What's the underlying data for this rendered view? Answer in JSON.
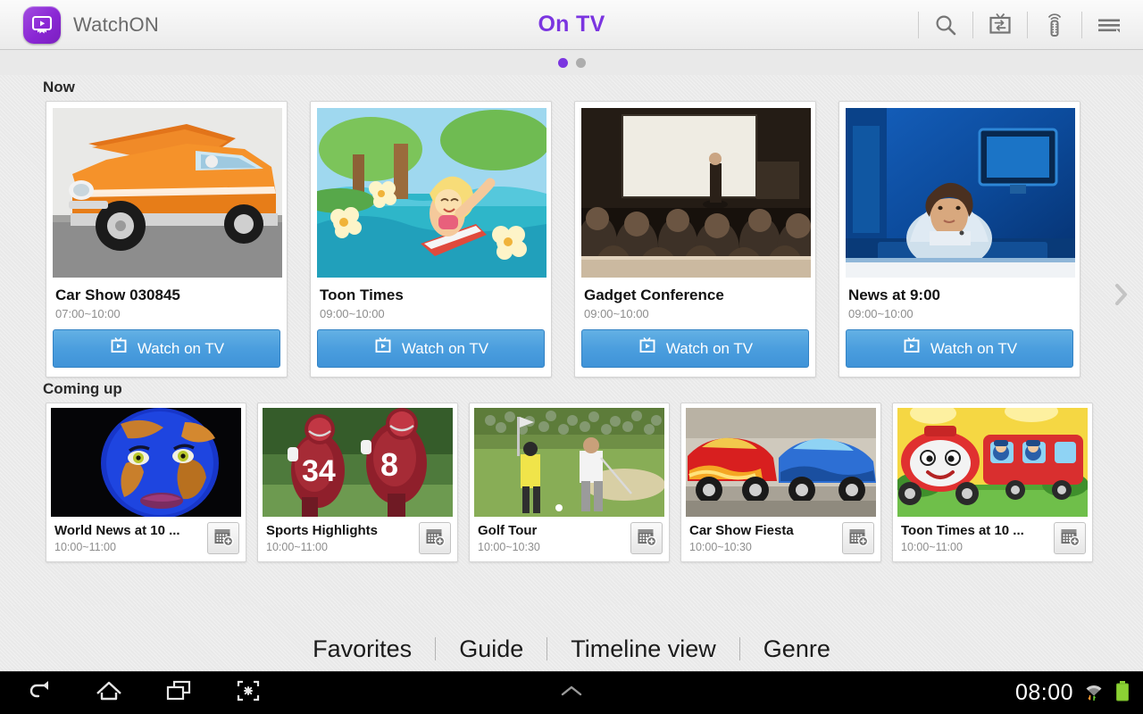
{
  "header": {
    "app_name": "WatchON",
    "title": "On TV",
    "logo_icon": "watchon-app-icon",
    "actions": [
      {
        "name": "search-icon",
        "label": "Search"
      },
      {
        "name": "tv-switch-icon",
        "label": "Change TV"
      },
      {
        "name": "remote-control-icon",
        "label": "Remote control"
      },
      {
        "name": "menu-icon",
        "label": "More options"
      }
    ]
  },
  "pager": {
    "dots": [
      {
        "state": "active"
      },
      {
        "state": "inactive"
      }
    ],
    "active_color": "#7b35e0",
    "inactive_color": "#adadad"
  },
  "sections": {
    "now_label": "Now",
    "coming_label": "Coming up"
  },
  "now": {
    "watch_label": "Watch on TV",
    "next_arrow_icon": "chevron-right-icon",
    "cards": [
      {
        "title": "Car Show 030845",
        "time": "07:00~10:00",
        "thumb": "classic-orange-car"
      },
      {
        "title": "Toon Times",
        "time": "09:00~10:00",
        "thumb": "cartoon-surfer-girl"
      },
      {
        "title": "Gadget Conference",
        "time": "09:00~10:00",
        "thumb": "conference-audience"
      },
      {
        "title": "News at 9:00",
        "time": "09:00~10:00",
        "thumb": "news-anchor-studio"
      }
    ]
  },
  "coming_up": {
    "record_icon": "calendar-add-icon",
    "cards": [
      {
        "title": "World News at 10 ...",
        "time": "10:00~11:00",
        "thumb": "world-map-face"
      },
      {
        "title": "Sports Highlights",
        "time": "10:00~11:00",
        "thumb": "football-players"
      },
      {
        "title": "Golf Tour",
        "time": "10:00~10:30",
        "thumb": "golf-course"
      },
      {
        "title": "Car Show Fiesta",
        "time": "10:00~10:30",
        "thumb": "hot-rod-cars"
      },
      {
        "title": "Toon Times at 10 ...",
        "time": "10:00~11:00",
        "thumb": "cartoon-train"
      }
    ]
  },
  "tabs": [
    {
      "label": "Favorites"
    },
    {
      "label": "Guide"
    },
    {
      "label": "Timeline view"
    },
    {
      "label": "Genre"
    }
  ],
  "system_bar": {
    "back_icon": "back-icon",
    "home_icon": "home-icon",
    "recents_icon": "recent-apps-icon",
    "screenshot_icon": "screenshot-icon",
    "drawer_icon": "chevron-up-icon",
    "clock": "08:00",
    "wifi_icon": "wifi-icon",
    "battery_icon": "battery-full-icon"
  }
}
